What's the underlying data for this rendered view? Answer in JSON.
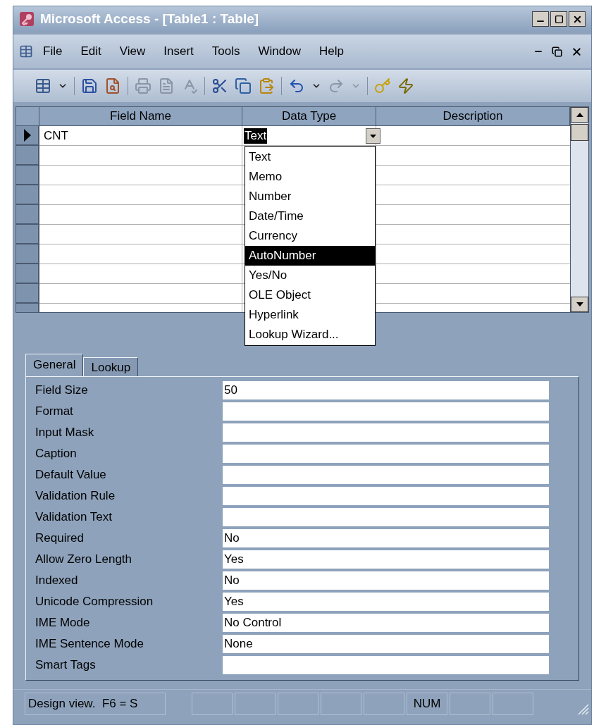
{
  "window": {
    "title": "Microsoft Access - [Table1 : Table]"
  },
  "menu": [
    {
      "label": "File"
    },
    {
      "label": "Edit"
    },
    {
      "label": "View"
    },
    {
      "label": "Insert"
    },
    {
      "label": "Tools"
    },
    {
      "label": "Window"
    },
    {
      "label": "Help"
    }
  ],
  "toolbar": [
    {
      "kind": "view",
      "disabled": false
    },
    {
      "kind": "dropdown",
      "disabled": false
    },
    {
      "kind": "sep"
    },
    {
      "kind": "save",
      "disabled": false
    },
    {
      "kind": "search",
      "disabled": false
    },
    {
      "kind": "sep"
    },
    {
      "kind": "print",
      "disabled": true
    },
    {
      "kind": "preview",
      "disabled": true
    },
    {
      "kind": "spell",
      "disabled": true
    },
    {
      "kind": "sep"
    },
    {
      "kind": "cut",
      "disabled": false
    },
    {
      "kind": "copy",
      "disabled": false
    },
    {
      "kind": "paste",
      "disabled": false
    },
    {
      "kind": "sep"
    },
    {
      "kind": "undo",
      "disabled": false
    },
    {
      "kind": "dropdown",
      "disabled": false
    },
    {
      "kind": "redo",
      "disabled": true
    },
    {
      "kind": "dropdown",
      "disabled": true
    },
    {
      "kind": "sep"
    },
    {
      "kind": "key",
      "disabled": false
    },
    {
      "kind": "build",
      "disabled": false
    }
  ],
  "table": {
    "columns": [
      "Field Name",
      "Data Type",
      "Description"
    ],
    "rows": [
      {
        "field_name": "CNT",
        "data_type": "Text",
        "current": true
      },
      {
        "current": false
      },
      {
        "current": false
      },
      {
        "current": false
      },
      {
        "current": false
      },
      {
        "current": false
      },
      {
        "current": false
      },
      {
        "current": false
      },
      {
        "current": false
      },
      {
        "current": false
      }
    ]
  },
  "data_type_dropdown": [
    {
      "label": "Text",
      "selected": false
    },
    {
      "label": "Memo",
      "selected": false
    },
    {
      "label": "Number",
      "selected": false
    },
    {
      "label": "Date/Time",
      "selected": false
    },
    {
      "label": "Currency",
      "selected": false
    },
    {
      "label": "AutoNumber",
      "selected": true
    },
    {
      "label": "Yes/No",
      "selected": false
    },
    {
      "label": "OLE Object",
      "selected": false
    },
    {
      "label": "Hyperlink",
      "selected": false
    },
    {
      "label": "Lookup Wizard...",
      "selected": false
    }
  ],
  "property_tabs": [
    {
      "label": "General",
      "selected": true
    },
    {
      "label": "Lookup",
      "selected": false
    }
  ],
  "properties": [
    {
      "label": "Field Size",
      "value": "50"
    },
    {
      "label": "Format"
    },
    {
      "label": "Input Mask"
    },
    {
      "label": "Caption"
    },
    {
      "label": "Default Value"
    },
    {
      "label": "Validation Rule"
    },
    {
      "label": "Validation Text"
    },
    {
      "label": "Required",
      "value": "No"
    },
    {
      "label": "Allow Zero Length",
      "value": "Yes"
    },
    {
      "label": "Indexed",
      "value": "No"
    },
    {
      "label": "Unicode Compression",
      "value": "Yes"
    },
    {
      "label": "IME Mode",
      "value": "No Control"
    },
    {
      "label": "IME Sentence Mode",
      "value": "None"
    },
    {
      "label": "Smart Tags"
    }
  ],
  "status_bar": {
    "message": "Design view.  F6 = S",
    "indicator": "NUM"
  }
}
